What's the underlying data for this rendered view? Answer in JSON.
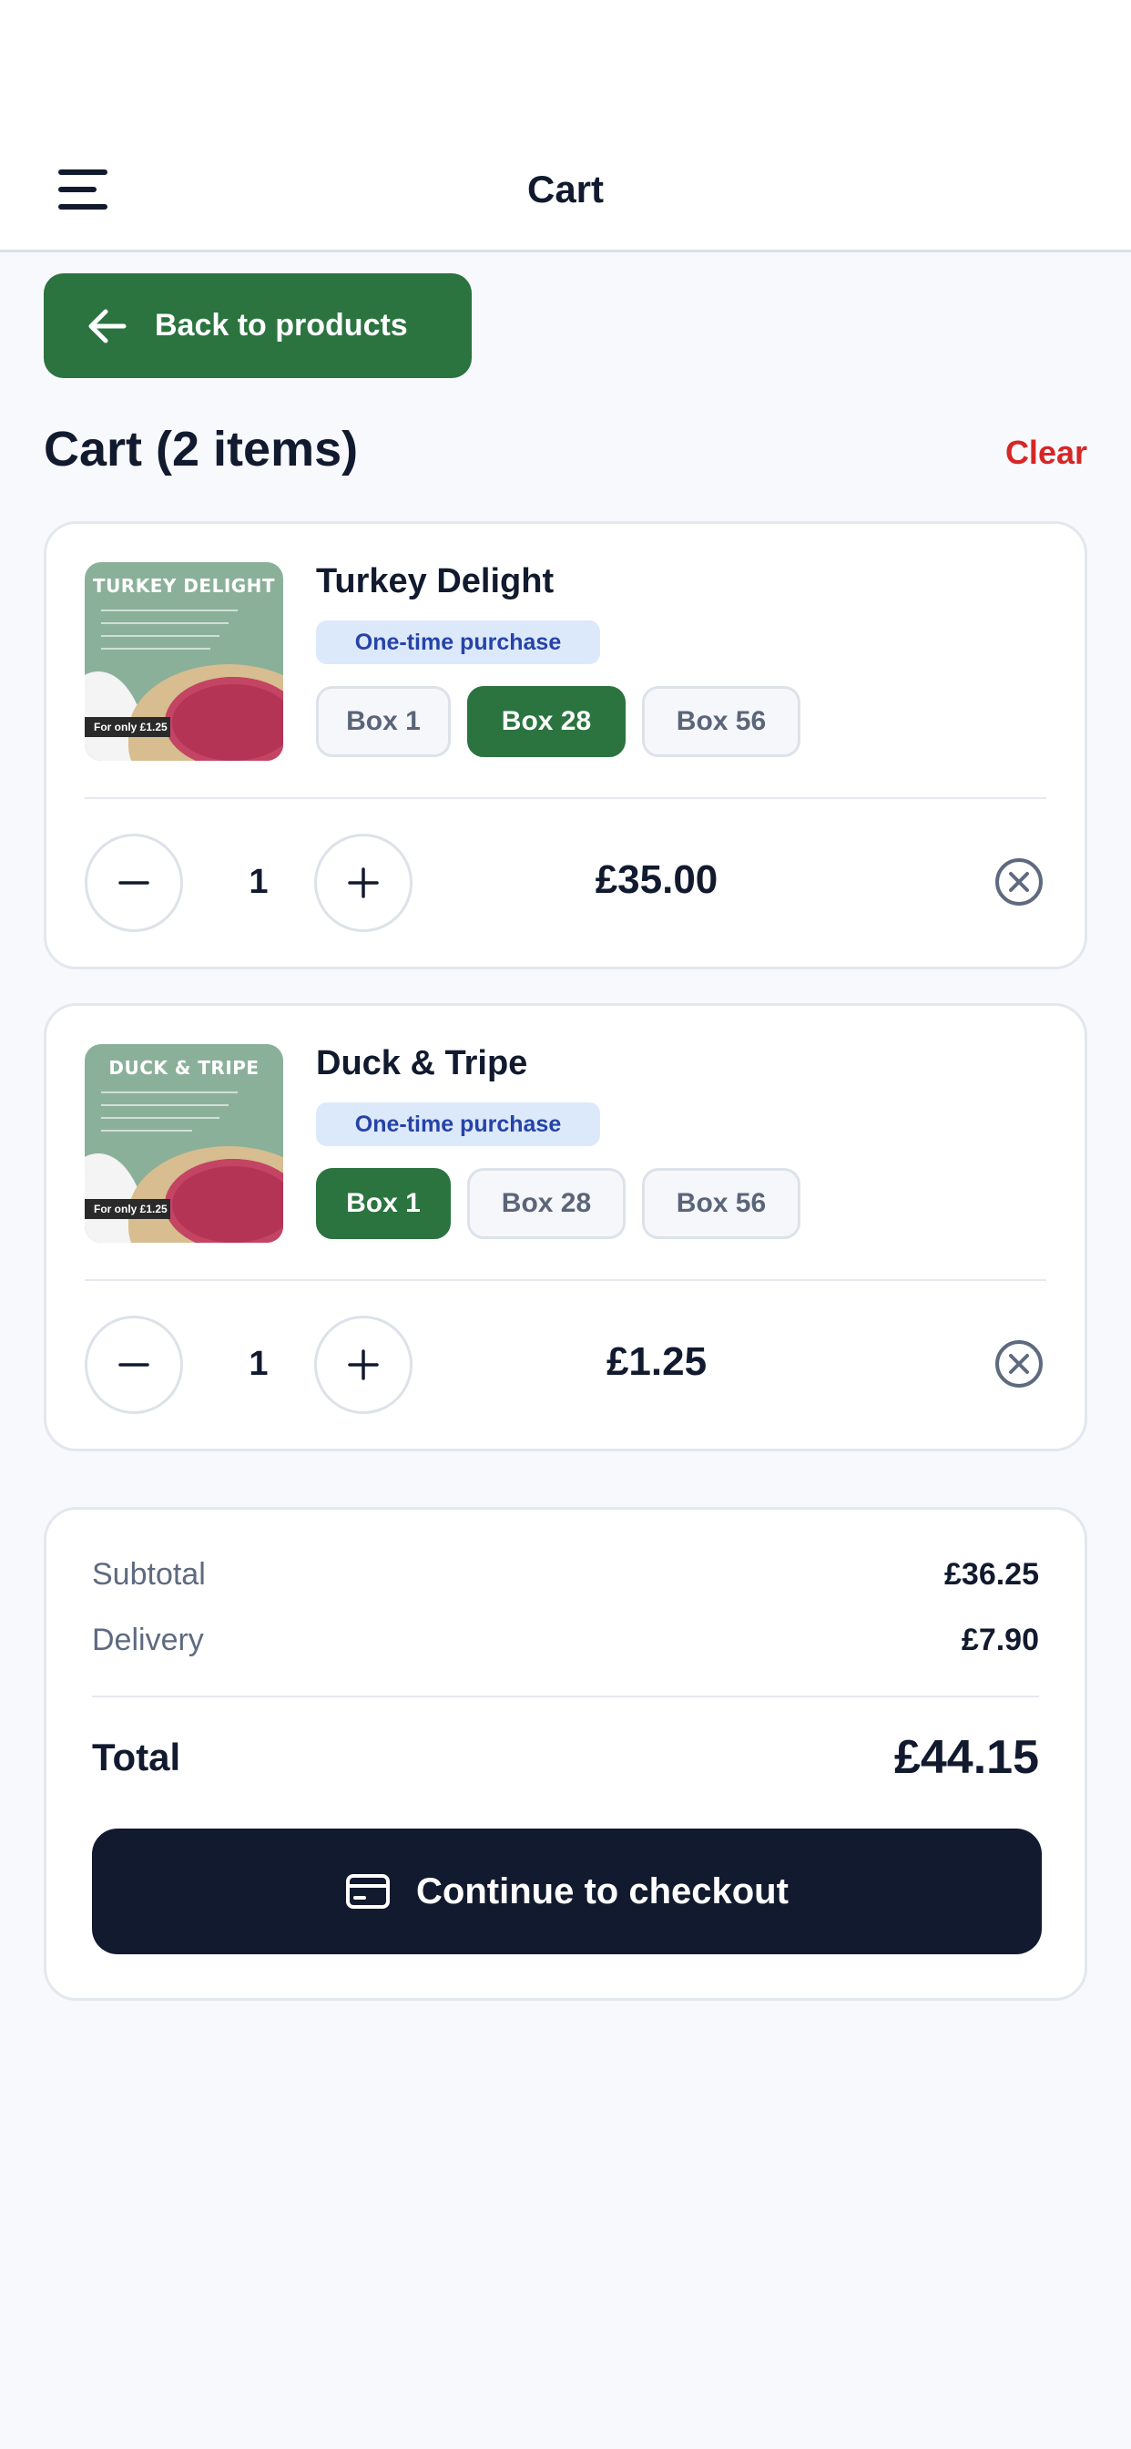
{
  "header": {
    "title": "Cart",
    "menu_icon": "hamburger-menu-icon"
  },
  "back_button": {
    "label": "Back to products",
    "icon": "arrow-left-icon"
  },
  "cart": {
    "heading": "Cart (2 items)",
    "clear_label": "Clear",
    "items": [
      {
        "name": "Turkey Delight",
        "image_title": "TURKEY DELIGHT",
        "image_tag": "For only £1.25",
        "purchase_type": "One-time purchase",
        "options": [
          "Box 1",
          "Box 28",
          "Box 56"
        ],
        "selected_option": "Box 28",
        "quantity": "1",
        "price": "£35.00"
      },
      {
        "name": "Duck & Tripe",
        "image_title": "DUCK & TRIPE",
        "image_tag": "For only £1.25",
        "purchase_type": "One-time purchase",
        "options": [
          "Box 1",
          "Box 28",
          "Box 56"
        ],
        "selected_option": "Box 1",
        "quantity": "1",
        "price": "£1.25"
      }
    ]
  },
  "summary": {
    "subtotal_label": "Subtotal",
    "subtotal_value": "£36.25",
    "delivery_label": "Delivery",
    "delivery_value": "£7.90",
    "total_label": "Total",
    "total_value": "£44.15",
    "checkout_label": "Continue to checkout",
    "checkout_icon": "credit-card-icon"
  },
  "colors": {
    "brand_green": "#2b733f",
    "danger_red": "#d72626",
    "dark_navy": "#111a2e",
    "badge_blue_bg": "#dce9fb",
    "badge_blue_text": "#2643a8"
  }
}
